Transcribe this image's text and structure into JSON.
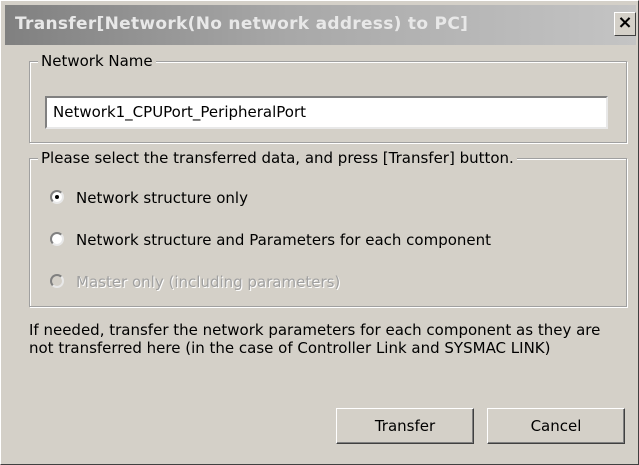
{
  "window": {
    "title": "Transfer[Network(No network address) to PC]",
    "close_label": "×"
  },
  "network_name": {
    "legend": "Network Name",
    "value": "Network1_CPUPort_PeripheralPort"
  },
  "transfer_selection": {
    "legend": "Please select the transferred data, and press [Transfer] button.",
    "options": [
      {
        "label": "Network structure only",
        "checked": true,
        "enabled": true
      },
      {
        "label": "Network structure and Parameters for each component",
        "checked": false,
        "enabled": true
      },
      {
        "label": "Master only (including parameters)",
        "checked": false,
        "enabled": false
      }
    ]
  },
  "note": "If needed, transfer the network parameters for each component as they are not transferred here (in the case of Controller Link and SYSMAC LINK)",
  "buttons": {
    "transfer_label": "Transfer",
    "cancel_label": "Cancel"
  }
}
